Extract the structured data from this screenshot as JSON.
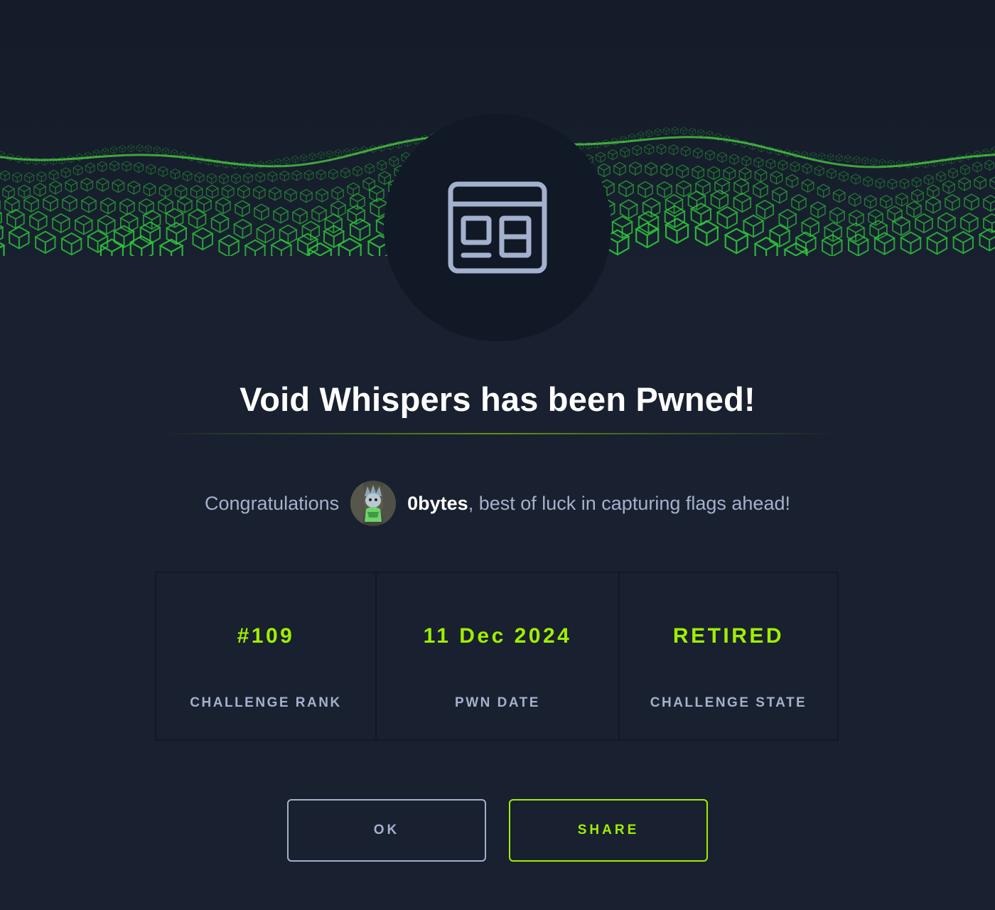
{
  "title": "Void Whispers has been Pwned!",
  "congrats": {
    "prefix": "Congratulations",
    "username": "0bytes",
    "suffix": ", best of luck in capturing flags ahead!"
  },
  "stats": [
    {
      "value": "#109",
      "label": "CHALLENGE RANK"
    },
    {
      "value": "11 Dec 2024",
      "label": "PWN DATE"
    },
    {
      "value": "RETIRED",
      "label": "CHALLENGE STATE"
    }
  ],
  "buttons": {
    "ok": "OK",
    "share": "SHARE"
  },
  "icons": {
    "challenge_category": "web-layout-icon",
    "avatar": "user-avatar"
  },
  "colors": {
    "background": "#19202f",
    "accent": "#9fef00",
    "muted_text": "#a4b1cd",
    "circle": "#111826",
    "wave": "#2fd13a"
  }
}
